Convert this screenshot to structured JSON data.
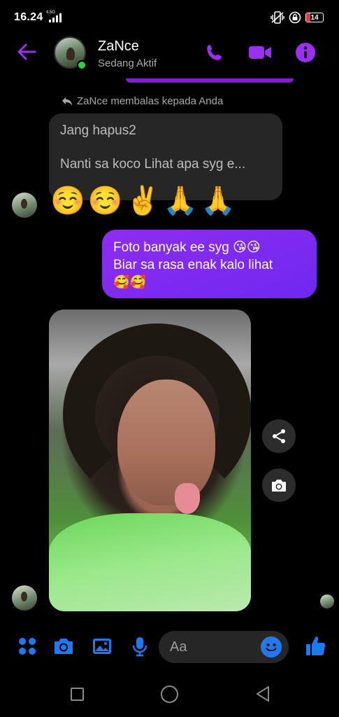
{
  "status_bar": {
    "time": "16.24",
    "network": "4.5G",
    "battery": "14"
  },
  "header": {
    "name": "ZaNce",
    "status": "Sedang Aktif"
  },
  "messages": {
    "reply_label": "ZaNce membalas kepada Anda",
    "reply_quote_line1": "Jang hapus2",
    "reply_quote_line2": "Nanti sa koco Lihat apa syg e...",
    "emoji_reply": "☺️☺️✌️🙏🙏",
    "outgoing_line1": "Foto banyak ee syg 😘😘",
    "outgoing_line2": "Biar sa rasa enak kalo lihat",
    "outgoing_line3": "🥰🥰"
  },
  "composer": {
    "placeholder": "Aa"
  },
  "colors": {
    "accent_purple": "#8e2df0",
    "messenger_blue": "#1f7af0",
    "online_green": "#31cc46"
  },
  "icons": [
    "back-arrow-icon",
    "phone-icon",
    "video-icon",
    "info-icon",
    "reply-icon",
    "share-icon",
    "camera-icon",
    "apps-icon",
    "gallery-icon",
    "mic-icon",
    "emoji-icon",
    "like-icon"
  ]
}
